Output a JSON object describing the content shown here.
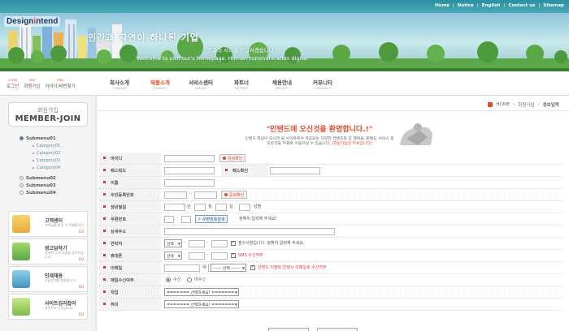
{
  "header": {
    "top_links": [
      "Home",
      "Notice",
      "English",
      "Contact us",
      "Sitemap"
    ],
    "logo": {
      "text_a": "Design",
      "text_b": "i",
      "text_c": "ntend"
    },
    "slogan": "인간과 자연이 하나된 기업",
    "slogan_sub": "행복의 시작에 첫발서겠습니다",
    "slogan_en": "Welcome to visit our's homepage. Human communication digital.",
    "util_links": [
      {
        "small": "LOGIN",
        "label": "로그인"
      },
      {
        "small": "JOIN",
        "label": "회원가입"
      },
      {
        "small": "FIND",
        "label": "아이디/비번찾기"
      }
    ],
    "menu": [
      {
        "label": "회사소개",
        "en": "COMPANY"
      },
      {
        "label": "제품소개",
        "en": "PRODUCT"
      },
      {
        "label": "서비스센터",
        "en": "SERVICE"
      },
      {
        "label": "파트너",
        "en": "PARTNER"
      },
      {
        "label": "채용안내",
        "en": "RECRUIT"
      },
      {
        "label": "커뮤니티",
        "en": "COMMUNITY"
      }
    ],
    "active_menu_index": 1
  },
  "sidebar": {
    "title_kr": "회원가입",
    "title_en": "MEMBER-JOIN",
    "submenus": [
      {
        "label": "Submenu01",
        "open": true,
        "categories": [
          "Category01",
          "Category02",
          "Category03",
          "Category04"
        ]
      },
      {
        "label": "Submenu02"
      },
      {
        "label": "Submenu03"
      },
      {
        "label": "Submenu04"
      }
    ],
    "boxes": [
      {
        "title": "고객센터",
        "desc": "고객님을 항상 수 주행합니다.",
        "more": "GO"
      },
      {
        "title": "광고담하기",
        "desc": "상세한 고객 도움을 찾아드립니다.",
        "more": "GO"
      },
      {
        "title": "인재채용",
        "desc": "고급인재를 채용합니다.",
        "more": "GO"
      },
      {
        "title": "사이트김라잡이",
        "desc": "사이트의 안내입니다.",
        "more": "GO"
      }
    ]
  },
  "breadcrumb": [
    "HOME",
    "회원가입",
    "정보입력"
  ],
  "welcome": {
    "title": "\"인텐드에 오신것을 환영합니다.!\"",
    "line1": "인텐드 회원이 되시면 당 사이트에서 제공되는 다양한 컨텐츠와 및 혜택을, 판매도 서비스 등",
    "line2_a": "모든것을 무료로 이용하실 수 있습니다.",
    "line2_b": "(회원가입은 무료입니다)"
  },
  "form": {
    "labels": {
      "id": "아이디",
      "password": "패스워드",
      "password_confirm": "패스확인",
      "name": "이름",
      "rrn": "주민등록번호",
      "birthday": "생년월일",
      "zipcode": "우편번호",
      "address": "상세주소",
      "phone": "연락처",
      "mobile": "휴대폰",
      "email": "이메일",
      "mail_receive": "메일수신여부",
      "job": "직업",
      "hobby": "취미"
    },
    "id_check_button": "중복확인",
    "rrn_check_button": "중복확인",
    "birthday_units": {
      "year": "년",
      "month": "월",
      "day": "일",
      "gender": "성별"
    },
    "zip_button": "우편번호검색",
    "zip_hint": "정확히 입력해 주세요!",
    "phone_select": "선택",
    "phone_note": "필수사항입니다. 정확히 입력해 주세요.",
    "mobile_select": "선택",
    "sms_label": "SMS 수신여부",
    "email_at": "@",
    "email_select": "------ 선택 ------",
    "email_note": "인텐드 이벤트 진행시 이메일로 수신여부",
    "mail_yes": "수신",
    "mail_no": "비수신",
    "job_select": "======= 선택하세요! =======",
    "hobby_select": "======= 선택하세요! =======",
    "dash": "-"
  },
  "colors": {
    "accent": "#e04c2c",
    "label_bullet": "#c93850",
    "teal": "#2a8fa2"
  }
}
